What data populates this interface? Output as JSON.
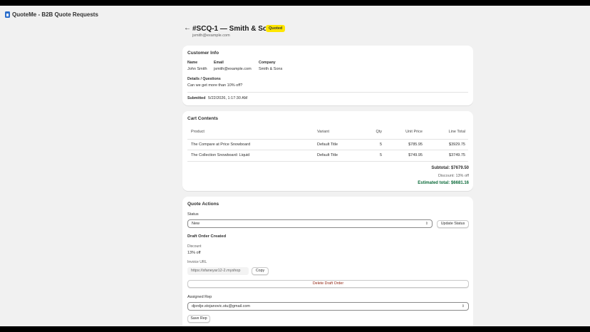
{
  "app": {
    "title": "QuoteMe - B2B Quote Requests"
  },
  "header": {
    "back_label": "←",
    "title": "#SCQ-1 — Smith & Sons",
    "status": "Quoted",
    "email": "jsmith@example.com"
  },
  "customer": {
    "section_title": "Customer Info",
    "name_label": "Name",
    "name": "John Smith",
    "email_label": "Email",
    "email": "jsmith@example.com",
    "company_label": "Company",
    "company": "Smith & Sons",
    "details_label": "Details / Questions",
    "details": "Can we get more than 10% off?",
    "submitted_label": "Submitted",
    "submitted": "5/22/2026, 1:17:30 AM"
  },
  "cart": {
    "section_title": "Cart Contents",
    "columns": [
      "Product",
      "Variant",
      "Qty",
      "Unit Price",
      "Line Total"
    ],
    "rows": [
      [
        "The Compare at Price Snowboard",
        "Default Title",
        "5",
        "$785.95",
        "$3929.75"
      ],
      [
        "The Collection Snowboard: Liquid",
        "Default Title",
        "5",
        "$749.95",
        "$3749.75"
      ]
    ],
    "subtotal": "Subtotal: $7679.50",
    "discount": "Discount: 13% off",
    "estimated_total": "Estimated total: $6681.16"
  },
  "actions": {
    "section_title": "Quote Actions",
    "status_label": "Status",
    "status_value": "New",
    "update_status_label": "Update Status",
    "draft_created_label": "Draft Order Created",
    "discount_label": "Discount",
    "discount_value": "13% off",
    "invoice_label": "Invoice URL",
    "invoice_value": "https://sfaneyar12-2.myshop",
    "copy_label": "Copy",
    "delete_draft_label": "Delete Draft Order",
    "assigned_rep_label": "Assigned Rep",
    "assigned_rep_value": "djordje.stojanovic.stu@gmail.com",
    "save_rep_label": "Save Rep"
  },
  "colors": {
    "accent_green": "#0c6b3a",
    "danger_red": "#8e1f0b",
    "status_yellow": "#ffe600"
  },
  "icons": [
    "app-icon",
    "back-arrow-icon",
    "chevron-updown-icon"
  ]
}
